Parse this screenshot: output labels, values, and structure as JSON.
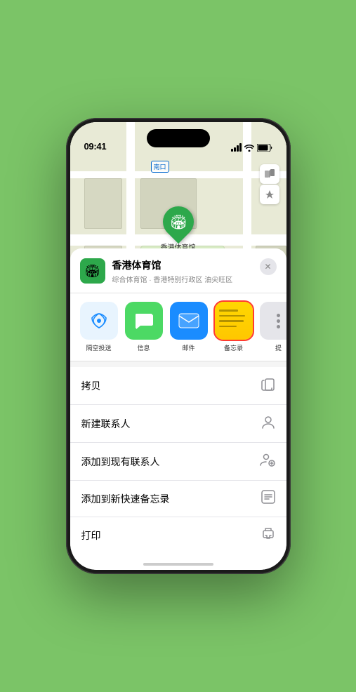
{
  "status_bar": {
    "time": "09:41",
    "signal": "signal-icon",
    "wifi": "wifi-icon",
    "battery": "battery-icon"
  },
  "map": {
    "label": "南口",
    "controls": {
      "map_type": "🗺",
      "location": "➤"
    },
    "venue_pin_label": "香港体育馆"
  },
  "venue_card": {
    "logo_emoji": "🏟",
    "name": "香港体育馆",
    "description": "综合体育馆 · 香港特别行政区 油尖旺区",
    "close_icon": "✕"
  },
  "share_items": [
    {
      "id": "airdrop",
      "label": "隔空投送",
      "type": "airdrop"
    },
    {
      "id": "messages",
      "label": "信息",
      "type": "messages"
    },
    {
      "id": "mail",
      "label": "邮件",
      "type": "mail"
    },
    {
      "id": "notes",
      "label": "备忘录",
      "type": "notes"
    },
    {
      "id": "more",
      "label": "提",
      "type": "more"
    }
  ],
  "actions": [
    {
      "id": "copy",
      "label": "拷贝",
      "icon": "📋"
    },
    {
      "id": "new-contact",
      "label": "新建联系人",
      "icon": "👤"
    },
    {
      "id": "add-existing",
      "label": "添加到现有联系人",
      "icon": "👤"
    },
    {
      "id": "add-notes",
      "label": "添加到新快速备忘录",
      "icon": "🗒"
    },
    {
      "id": "print",
      "label": "打印",
      "icon": "🖨"
    }
  ]
}
